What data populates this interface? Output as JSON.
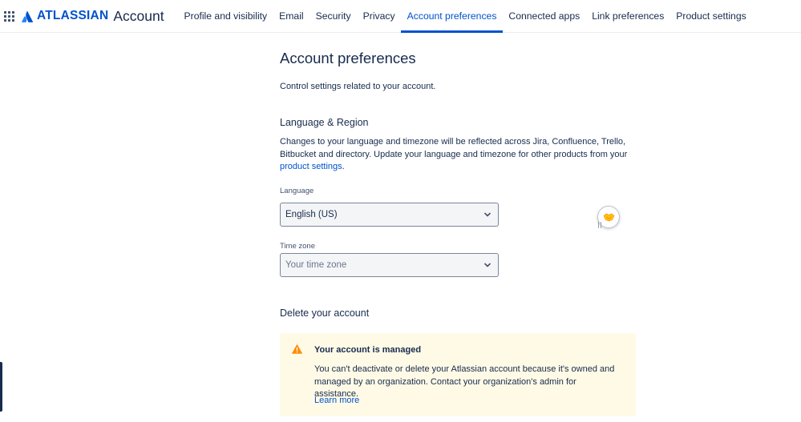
{
  "header": {
    "logo_brand": "ATLASSIAN",
    "logo_product": "Account",
    "tabs": [
      {
        "label": "Profile and visibility",
        "active": false
      },
      {
        "label": "Email",
        "active": false
      },
      {
        "label": "Security",
        "active": false
      },
      {
        "label": "Privacy",
        "active": false
      },
      {
        "label": "Account preferences",
        "active": true
      },
      {
        "label": "Connected apps",
        "active": false
      },
      {
        "label": "Link preferences",
        "active": false
      },
      {
        "label": "Product settings",
        "active": false
      }
    ]
  },
  "page": {
    "title": "Account preferences",
    "description": "Control settings related to your account."
  },
  "language_region": {
    "heading": "Language & Region",
    "description": "Changes to your language and timezone will be reflected across Jira, Confluence, Trello, Bitbucket and directory. Update your language and timezone for other products from your",
    "link_text": "product settings",
    "link_suffix": ".",
    "language_label": "Language",
    "language_value": "English (US)",
    "timezone_label": "Time zone",
    "timezone_placeholder": "Your time zone"
  },
  "delete_account": {
    "heading": "Delete your account",
    "warning_title": "Your account is managed",
    "warning_body": "You can't deactivate or delete your Atlassian account because it's owned and managed by an organization. Contact your organization's admin for assistance.",
    "learn_more": "Learn more"
  },
  "icons": {
    "app_switcher": "grid-icon",
    "chevron": "chevron-down-icon",
    "warning": "warning-icon",
    "widget": "handshake-icon"
  },
  "colors": {
    "brand": "#0052cc",
    "text": "#172b4d",
    "warning_bg": "#fffae6",
    "warning_icon": "#ff8b00"
  }
}
